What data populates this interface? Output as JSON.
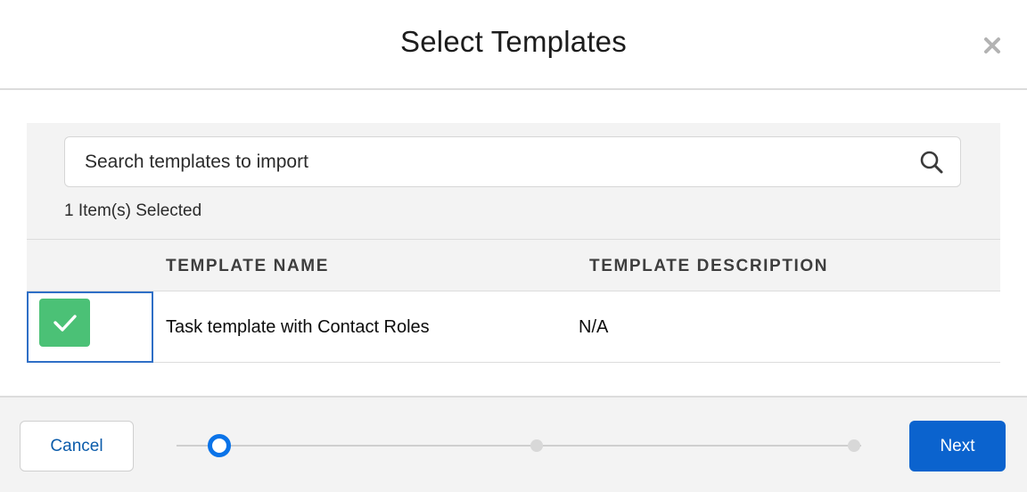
{
  "modal": {
    "title": "Select Templates"
  },
  "search": {
    "placeholder": "Search templates to import",
    "value": ""
  },
  "selection": {
    "summary": "1 Item(s) Selected"
  },
  "table": {
    "headers": [
      "TEMPLATE NAME",
      "TEMPLATE DESCRIPTION"
    ],
    "rows": [
      {
        "name": "Task template with Contact Roles",
        "description": "N/A",
        "selected": true
      }
    ]
  },
  "footer": {
    "cancel_label": "Cancel",
    "next_label": "Next",
    "progress": {
      "total_steps": 3,
      "current_step": 1
    }
  },
  "colors": {
    "accent": "#0b63ce",
    "check": "#4bc176",
    "link": "#0b5cab"
  },
  "icons": {
    "close": "close-icon",
    "search": "search-icon",
    "check": "checkmark-icon"
  }
}
